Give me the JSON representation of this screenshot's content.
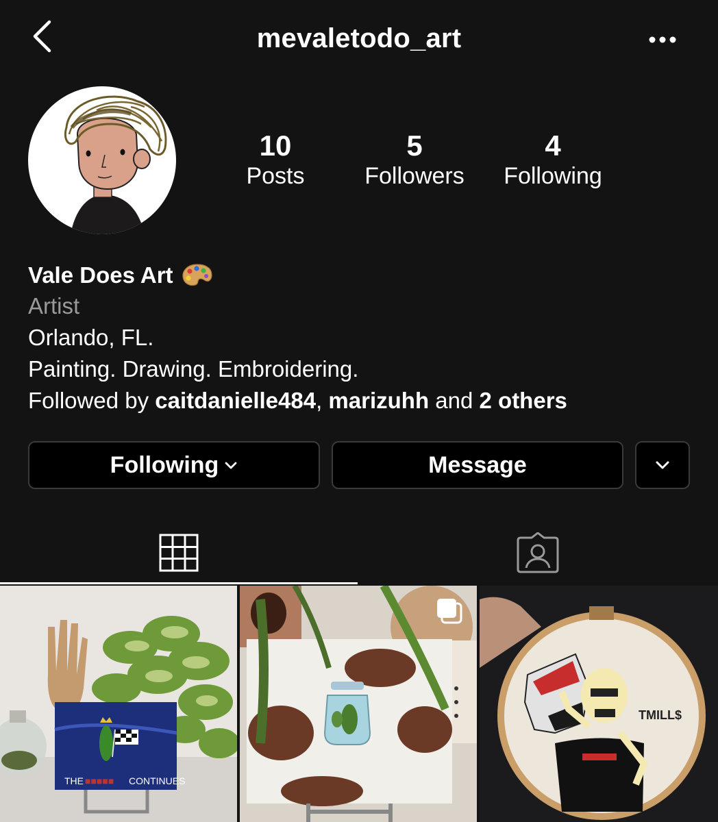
{
  "header": {
    "username": "mevaletodo_art",
    "back_icon": "chevron-left-icon",
    "more_icon": "ellipsis-icon"
  },
  "stats": [
    {
      "value": "10",
      "label": "Posts"
    },
    {
      "value": "5",
      "label": "Followers"
    },
    {
      "value": "4",
      "label": "Following"
    }
  ],
  "bio": {
    "name": "Vale Does Art",
    "name_emoji": "palette-icon",
    "category": "Artist",
    "location": "Orlando, FL.",
    "description": "Painting. Drawing. Embroidering.",
    "followed_by_prefix": "Followed by",
    "followed_user_1": "caitdanielle484",
    "followed_separator": ",",
    "followed_user_2": "marizuhh",
    "followed_and": "and",
    "followed_others": "2 others"
  },
  "buttons": {
    "following": "Following",
    "message": "Message"
  },
  "tabs": {
    "grid_icon": "grid-icon",
    "tagged_icon": "tagged-user-icon"
  },
  "posts": [
    {
      "caption_art": "THE",
      "caption_art_2": "CONTINUES"
    },
    {
      "multi_icon": "carousel-icon"
    },
    {
      "art_text": "TMILL$"
    }
  ],
  "colors": {
    "background": "#131313",
    "button_bg": "#000000",
    "button_border": "#3a3a3a",
    "muted_text": "#9a9a9a"
  }
}
